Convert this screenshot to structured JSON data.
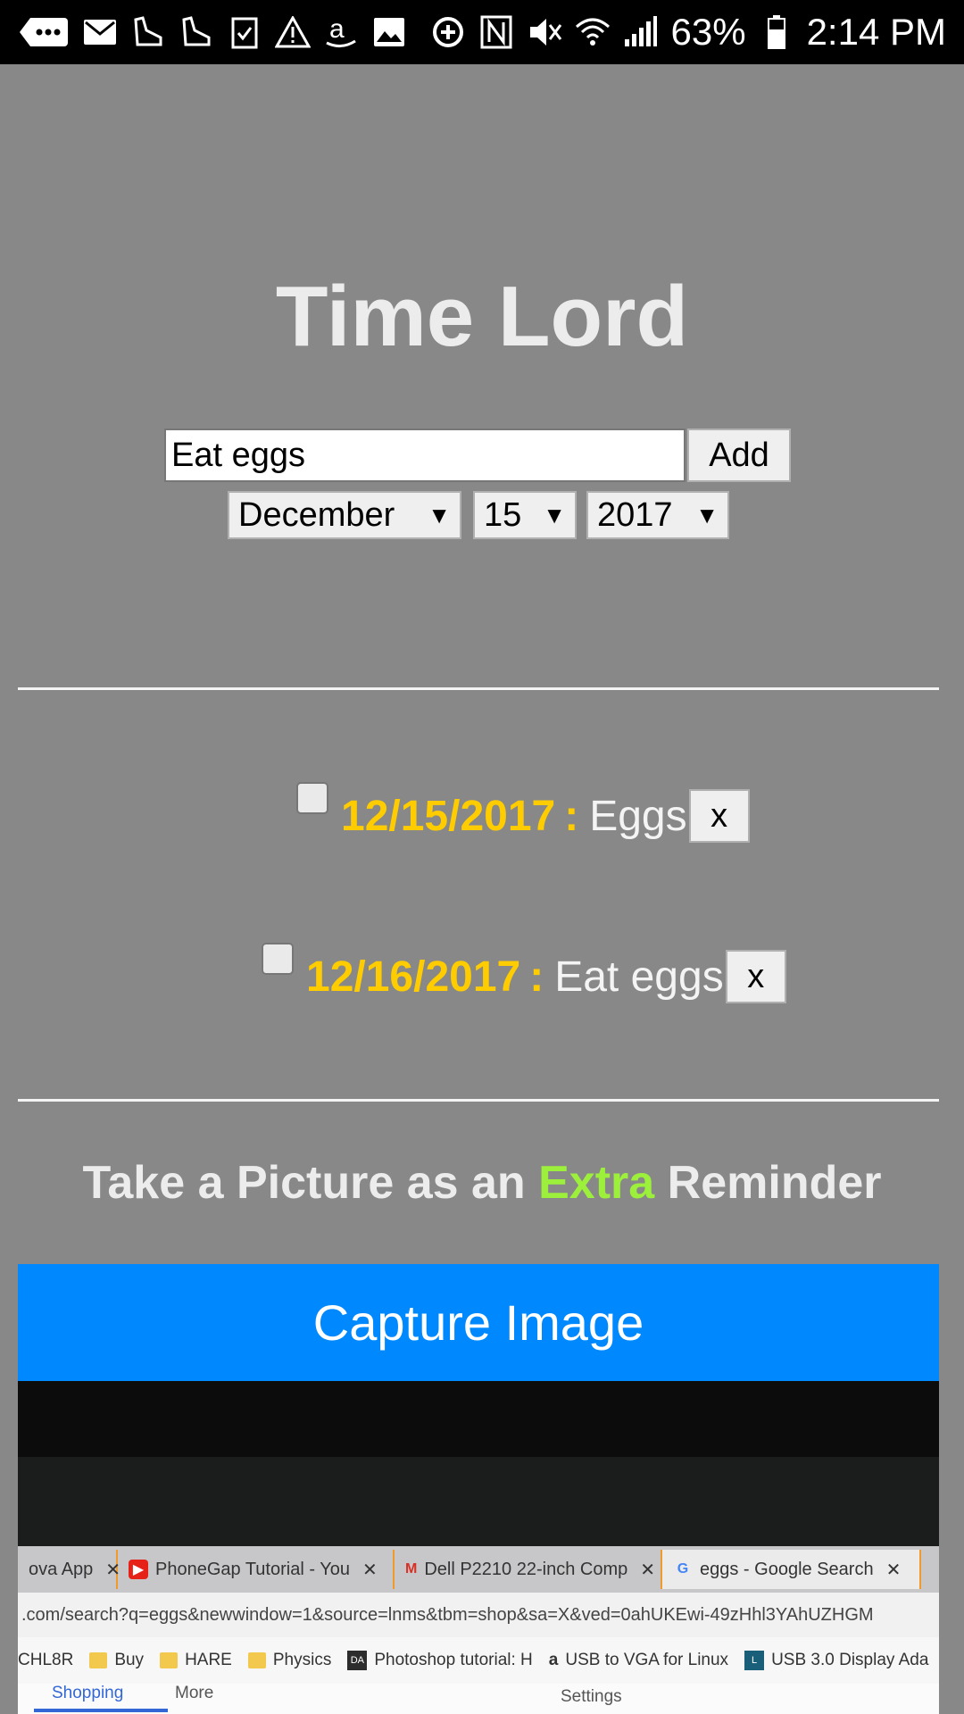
{
  "status_bar": {
    "battery": "63%",
    "time": "2:14 PM",
    "left_icons": [
      "more-icon",
      "mail-icon",
      "shoe-icon",
      "shoe-icon",
      "clipboard-check-icon",
      "warning-icon",
      "amazon-icon",
      "image-icon"
    ],
    "right_icons": [
      "sync-icon",
      "nfc-icon",
      "mute-icon",
      "wifi-icon",
      "signal-icon",
      "battery-icon"
    ]
  },
  "app": {
    "title": "Time Lord",
    "input_value": "Eat eggs",
    "add_label": "Add",
    "month": "December",
    "day": "15",
    "year": "2017"
  },
  "todos": [
    {
      "date": "12/15/2017",
      "sep": ":",
      "text": "Eggs",
      "remove": "x"
    },
    {
      "date": "12/16/2017",
      "sep": ":",
      "text": "Eat eggs",
      "remove": "x"
    }
  ],
  "picture": {
    "heading_before": "Take a Picture as an",
    "heading_extra": "Extra",
    "heading_after": "Reminder",
    "capture_label": "Capture Image"
  },
  "photo": {
    "tabs": [
      "ova App",
      "PhoneGap Tutorial - You",
      "Dell P2210 22-inch Comp",
      "eggs - Google Search"
    ],
    "url": ".com/search?q=eggs&newwindow=1&source=lnms&tbm=shop&sa=X&ved=0ahUKEwi-49zHhl3YAhUZHGM",
    "bookmarks": [
      "CHL8R",
      "Buy",
      "HARE",
      "Physics",
      "Photoshop tutorial: H",
      "USB to VGA for Linux",
      "USB 3.0 Display Ada"
    ],
    "bottom": [
      "Shopping",
      "More",
      "Settings"
    ]
  },
  "colors": {
    "background": "#888888",
    "date": "#ffcc00",
    "extra": "#9cf03c",
    "capture": "#0089ff"
  }
}
